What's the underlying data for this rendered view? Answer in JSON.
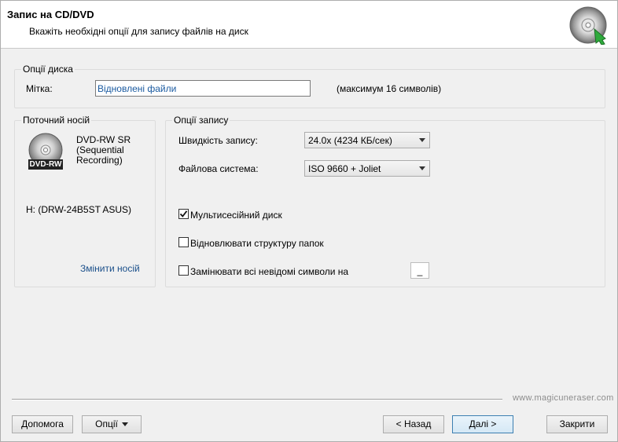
{
  "header": {
    "title": "Запис на CD/DVD",
    "subtitle": "Вкажіть необхідні опції для запису файлів на диск",
    "icon": "cd-burn-icon"
  },
  "disc_options": {
    "group_title": "Опції диска",
    "label_caption": "Мітка:",
    "label_value": "Відновлені файли",
    "label_hint": "(максимум 16 символів)"
  },
  "current_media": {
    "group_title": "Поточний носій",
    "media_type_line1": "DVD-RW SR",
    "media_type_line2": "(Sequential",
    "media_type_line3": "Recording)",
    "disc_badge": "DVD-RW",
    "drive": "H: (DRW-24B5ST ASUS)",
    "change_link": "Змінити носій"
  },
  "write_options": {
    "group_title": "Опції запису",
    "speed_label": "Швидкість запису:",
    "speed_value": "24.0x (4234 КБ/сек)",
    "fs_label": "Файлова система:",
    "fs_value": "ISO 9660 + Joliet",
    "multisession_label": "Мультисесійний диск",
    "multisession_checked": true,
    "restore_structure_label": "Відновлювати структуру папок",
    "restore_structure_checked": false,
    "replace_chars_label": "Замінювати всі невідомі символи на",
    "replace_chars_checked": false,
    "replace_char_value": "_"
  },
  "footer": {
    "website": "www.magicuneraser.com",
    "help_button": "Допомога",
    "options_button": "Опції",
    "back_button": "< Назад",
    "next_button": "Далі >",
    "close_button": "Закрити"
  },
  "colors": {
    "header_bg": "#ffffff",
    "window_bg": "#f0f0f0",
    "link": "#1a4f8a",
    "accent_green": "#2eaa3c"
  }
}
